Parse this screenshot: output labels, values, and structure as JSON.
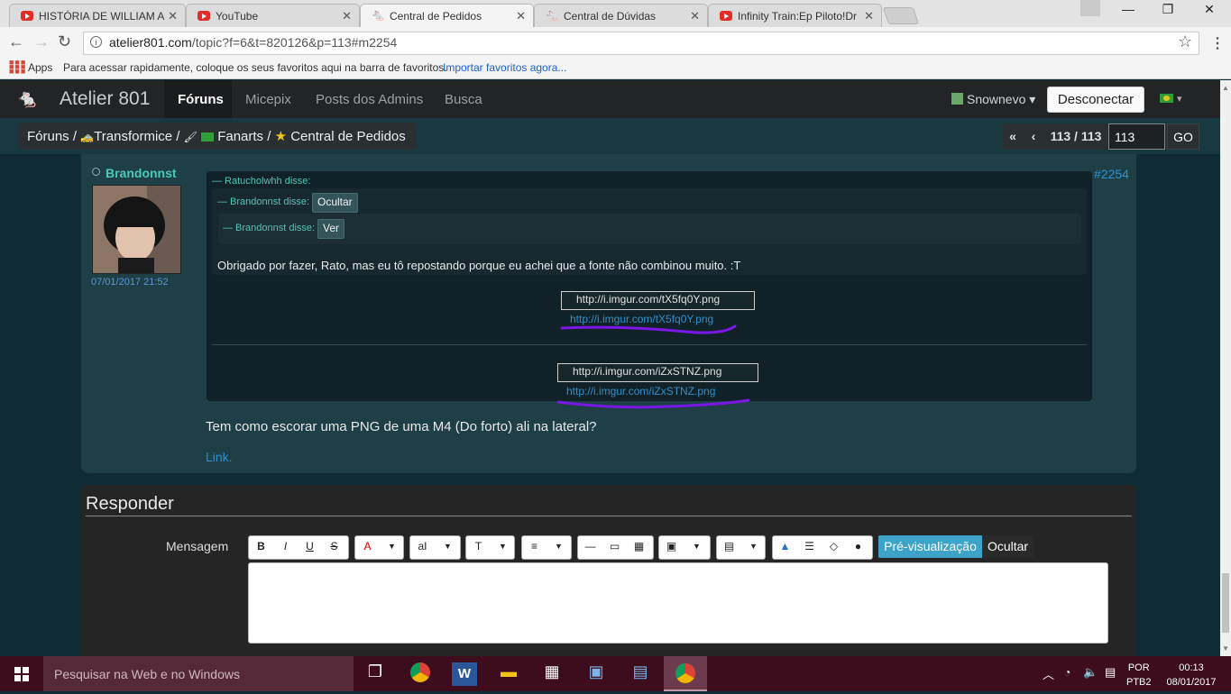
{
  "browser": {
    "tabs": [
      {
        "label": "HISTÓRIA DE WILLIAM A",
        "active": false
      },
      {
        "label": "YouTube",
        "active": false
      },
      {
        "label": "Central de Pedidos",
        "active": true
      },
      {
        "label": "Central de Dúvidas",
        "active": false
      },
      {
        "label": "Infinity Train:Ep Piloto!Dr",
        "active": false
      }
    ],
    "url_host": "atelier801.com",
    "url_path": "/topic?f=6&t=820126&p=113#m2254",
    "bookmarks_apps": "Apps",
    "bookmarks_hint": "Para acessar rapidamente, coloque os seus favoritos aqui na barra de favoritos.",
    "bookmarks_import": "Importar favoritos agora..."
  },
  "site": {
    "logo": "Atelier 801",
    "nav": [
      "Fóruns",
      "Micepix",
      "Posts dos Admins",
      "Busca"
    ],
    "username": "Snownevo",
    "disconnect": "Desconectar"
  },
  "breadcrumb": {
    "forums": "Fóruns /",
    "transformice": "Transformice /",
    "fanarts": "Fanarts /",
    "section": "Central de Pedidos"
  },
  "pager": {
    "first": "«",
    "prev": "‹",
    "current": "113 / 113",
    "input": "113",
    "go": "GO"
  },
  "post": {
    "author": "Brandonnst",
    "date": "07/01/2017 21:52",
    "number": "#2254",
    "quote1_author": "— Ratucholwhh disse:",
    "quote2_author": "— Brandonnst disse:",
    "quote2_button": "Ocultar",
    "quote3_author": "— Brandonnst disse:",
    "quote3_button": "Ver",
    "quote_text": "Obrigado por fazer, Rato, mas eu tô repostando porque eu achei que a fonte não combinou muito. :T",
    "image1_alt": "http://i.imgur.com/tX5fq0Y.png",
    "image1_link": "http://i.imgur.com/tX5fq0Y.png",
    "image2_alt": "http://i.imgur.com/iZxSTNZ.png",
    "image2_link": "http://i.imgur.com/iZxSTNZ.png",
    "question": "Tem como escorar uma PNG de uma M4 (Do forto) ali na lateral?",
    "link": "Link."
  },
  "reply": {
    "title": "Responder",
    "message_label": "Mensagem",
    "preview": "Pré-visualização",
    "hide": "Ocultar"
  },
  "taskbar": {
    "search_placeholder": "Pesquisar na Web e no Windows",
    "lang1": "POR",
    "lang2": "PTB2",
    "time": "00:13",
    "date": "08/01/2017"
  },
  "colors": {
    "accent_teal": "#4dc7b8",
    "link_blue": "#2f8fcf",
    "annotation_purple": "#7a16e6"
  }
}
